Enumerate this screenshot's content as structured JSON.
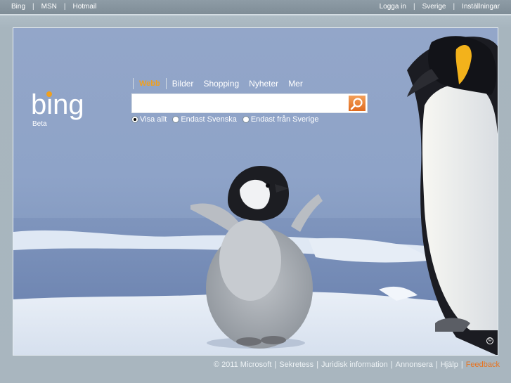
{
  "topbar": {
    "left": [
      {
        "label": "Bing"
      },
      {
        "label": "MSN"
      },
      {
        "label": "Hotmail"
      }
    ],
    "right": [
      {
        "label": "Logga in"
      },
      {
        "label": "Sverige"
      },
      {
        "label": "Inställningar"
      }
    ],
    "separator": "|"
  },
  "logo": {
    "text": "bing",
    "subtitle": "Beta"
  },
  "tabs": [
    {
      "label": "Webb",
      "active": true
    },
    {
      "label": "Bilder"
    },
    {
      "label": "Shopping"
    },
    {
      "label": "Nyheter"
    },
    {
      "label": "Mer"
    }
  ],
  "search": {
    "value": "",
    "placeholder": "",
    "button_icon": "search-icon"
  },
  "radios": [
    {
      "label": "Visa allt",
      "checked": true
    },
    {
      "label": "Endast Svenska",
      "checked": false
    },
    {
      "label": "Endast från Sverige",
      "checked": false
    }
  ],
  "hero": {
    "copyright_mark": "©"
  },
  "footer": {
    "items": [
      "© 2011 Microsoft",
      "Sekretess",
      "Juridisk information",
      "Annonsera",
      "Hjälp"
    ],
    "feedback": "Feedback",
    "separator": "|"
  },
  "colors": {
    "accent": "#f0a01e",
    "feedback": "#e8731e",
    "search_button": "#e06a1e",
    "topbar": "#8e9ca6"
  }
}
